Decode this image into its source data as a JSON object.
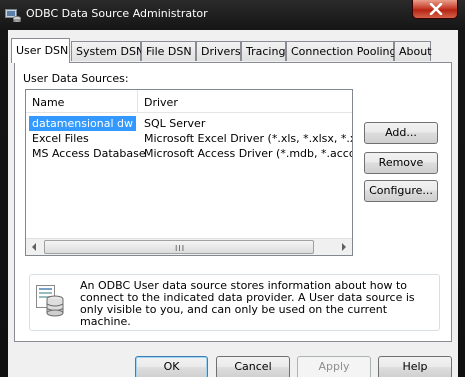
{
  "window": {
    "title": "ODBC Data Source Administrator",
    "close_glyph": "×"
  },
  "tabs": [
    {
      "label": "User DSN",
      "active": true
    },
    {
      "label": "System DSN",
      "active": false
    },
    {
      "label": "File DSN",
      "active": false
    },
    {
      "label": "Drivers",
      "active": false
    },
    {
      "label": "Tracing",
      "active": false
    },
    {
      "label": "Connection Pooling",
      "active": false
    },
    {
      "label": "About",
      "active": false
    }
  ],
  "user_dsn": {
    "group_label": "User Data Sources:",
    "columns": {
      "name": "Name",
      "driver": "Driver"
    },
    "rows": [
      {
        "name": "datamensional dw",
        "driver": "SQL Server",
        "selected": true
      },
      {
        "name": "Excel Files",
        "driver": "Microsoft Excel Driver (*.xls, *.xlsx, *.xlsm, *.xl",
        "selected": false
      },
      {
        "name": "MS Access Database",
        "driver": "Microsoft Access Driver (*.mdb, *.accdb)",
        "selected": false
      }
    ],
    "scroll_grip": "III",
    "buttons": {
      "add": "Add...",
      "remove": "Remove",
      "configure": "Configure..."
    },
    "info_text": "An ODBC User data source stores information about how to connect to the indicated data provider.  A User data source is only visible to you, and can only be used on the current machine."
  },
  "dialog_buttons": {
    "ok": "OK",
    "cancel": "Cancel",
    "apply": "Apply",
    "help": "Help"
  },
  "colors": {
    "selection": "#3399ff",
    "title_bar": "#151515",
    "close_button": "#c7402c"
  }
}
